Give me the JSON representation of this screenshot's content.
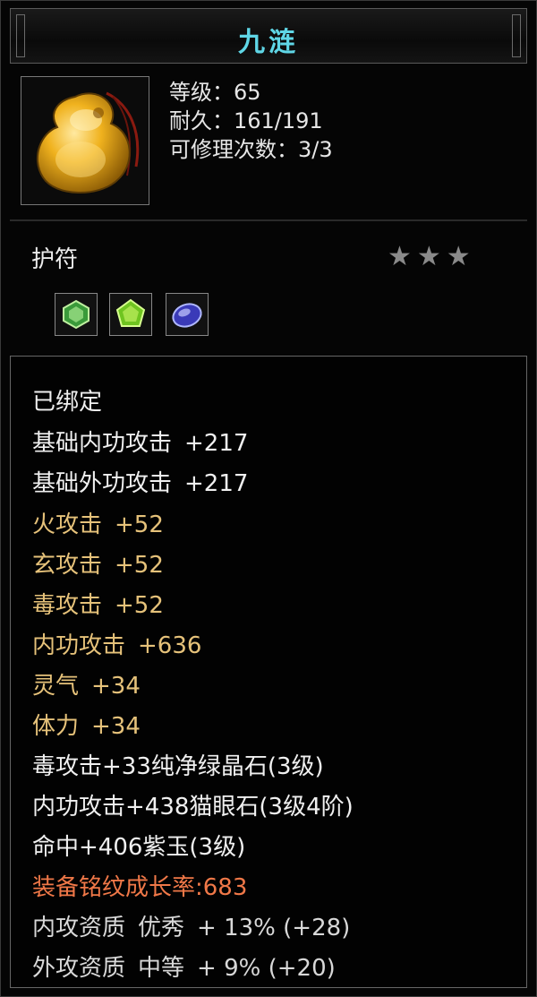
{
  "item": {
    "name": "九涟",
    "stats": [
      "等级：65",
      "耐久：161/191",
      "可修理次数：3/3"
    ],
    "type_label": "护符",
    "star_count": 3,
    "stars_text": "★★★",
    "gems": [
      "green-gem-icon",
      "lime-gem-icon",
      "purple-gem-icon"
    ]
  },
  "attributes": {
    "bound": "已绑定",
    "base_inner_label": "基础内功攻击",
    "base_inner_value": "+217",
    "base_outer_label": "基础外功攻击",
    "base_outer_value": "+217",
    "fire_label": "火攻击",
    "fire_value": "+52",
    "xuan_label": "玄攻击",
    "xuan_value": "+52",
    "poison_label": "毒攻击",
    "poison_value": "+52",
    "inner_label": "内功攻击",
    "inner_value": "+636",
    "spirit_label": "灵气",
    "spirit_value": "+34",
    "stamina_label": "体力",
    "stamina_value": "+34",
    "gem_line_1": "毒攻击+33纯净绿晶石(3级)",
    "gem_line_2": "内功攻击+438猫眼石(3级4阶)",
    "gem_line_3": "命中+406紫玉(3级)",
    "growth_rate": "装备铭纹成长率:683",
    "inner_quality_label": "内攻资质",
    "inner_quality_grade": "优秀",
    "inner_quality_value": "+ 13% (+28)",
    "outer_quality_label": "外攻资质",
    "outer_quality_grade": "中等",
    "outer_quality_value": "+ 9% (+20)"
  },
  "colors": {
    "title": "#5fd6e6",
    "white": "#f0f0f0",
    "yellow": "#e6c27a",
    "orange": "#f07848"
  }
}
